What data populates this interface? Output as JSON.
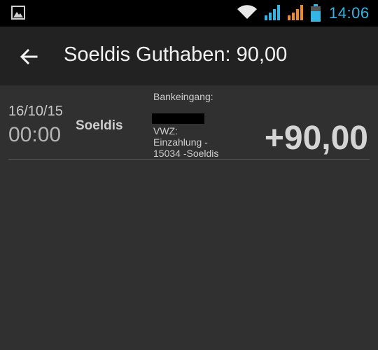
{
  "status_bar": {
    "time": "14:06",
    "icons": [
      "gallery-icon",
      "wifi-icon",
      "signal-icon",
      "signal-icon",
      "battery-icon"
    ],
    "accent_color": "#33b5e5",
    "signal2_color": "#f08a24"
  },
  "header": {
    "title": "Soeldis Guthaben: 90,00",
    "back_icon": "arrow-left-icon"
  },
  "transactions": [
    {
      "date": "16/10/15",
      "time": "00:00",
      "name": "Soeldis",
      "description_label": "Bankeingang:",
      "description_lines": [
        "VWZ:",
        "Einzahlung -",
        "15034 -Soeldis"
      ],
      "amount": "+90,00"
    }
  ]
}
